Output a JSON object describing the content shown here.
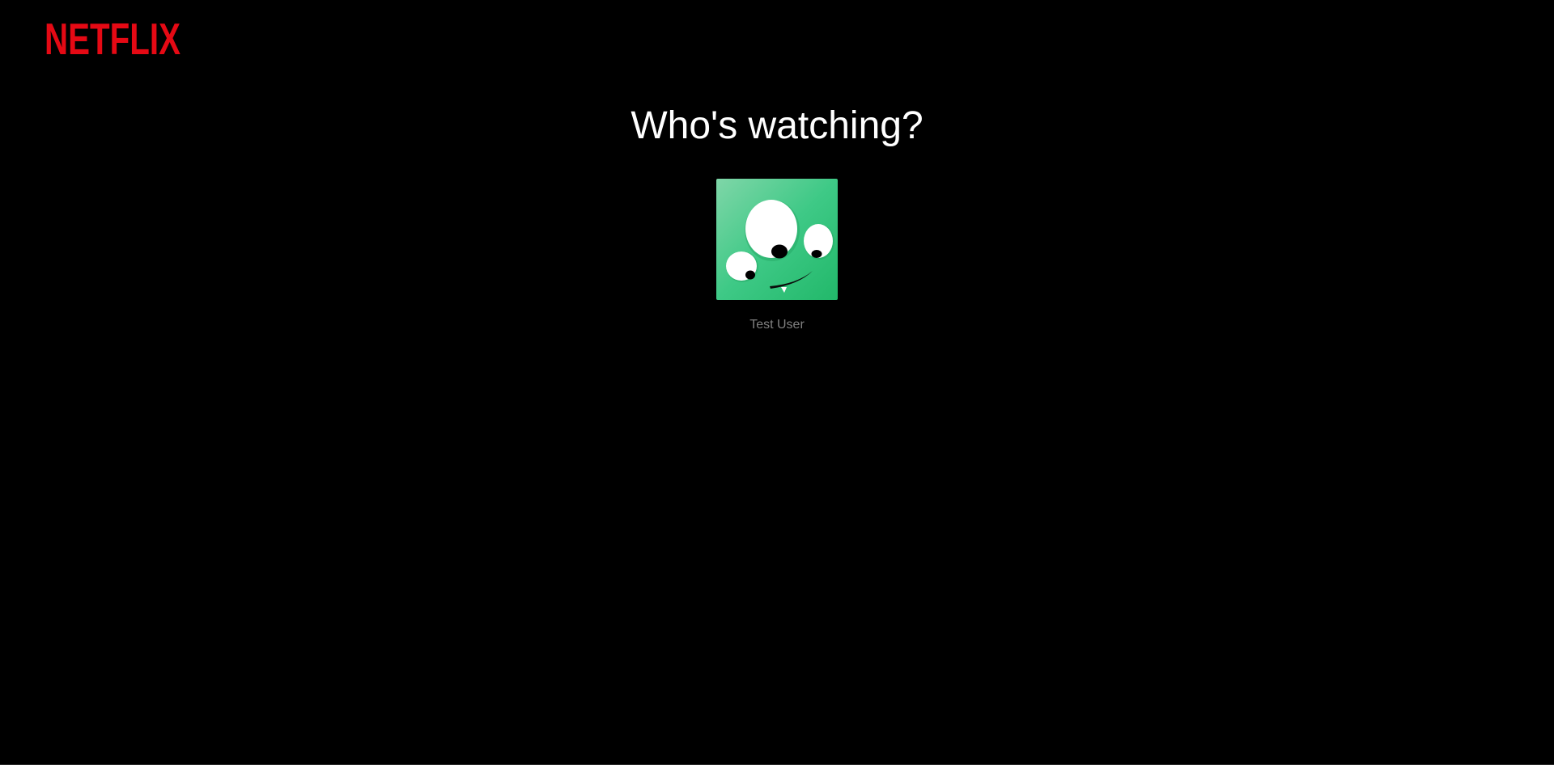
{
  "header": {
    "logo_text": "NETFLIX",
    "brand_color": "#E50914"
  },
  "main": {
    "title": "Who's watching?",
    "profiles": [
      {
        "name": "Test User",
        "avatar_icon": "green-three-eyed-monster-avatar-icon",
        "avatar_color": "#2DBE74"
      }
    ]
  },
  "colors": {
    "background": "#000000",
    "title_text": "#FFFFFF",
    "profile_name_text": "#808080"
  }
}
